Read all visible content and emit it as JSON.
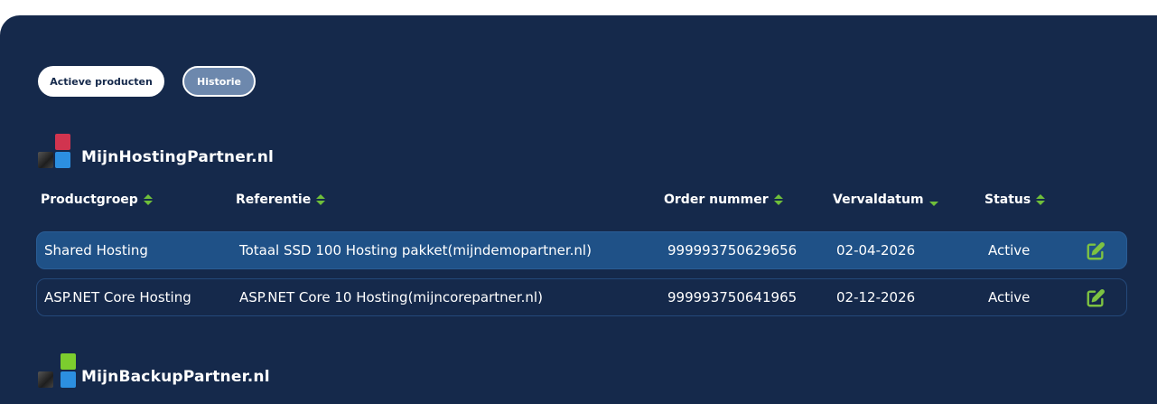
{
  "tabs": {
    "active": "Actieve producten",
    "history": "Historie"
  },
  "brands": [
    {
      "name": "MijnHostingPartner.nl",
      "logo_colors": [
        "#d1344f",
        "#2b2b2b",
        "#2c8fe0"
      ]
    },
    {
      "name": "MijnBackupPartner.nl",
      "logo_colors": [
        "#7ccd2e",
        "#2b2b2b",
        "#2c8fe0"
      ]
    }
  ],
  "table": {
    "columns": [
      "Productgroep",
      "Referentie",
      "Order nummer",
      "Vervaldatum",
      "Status"
    ],
    "rows": [
      {
        "productgroep": "Shared Hosting",
        "referentie": "Totaal SSD 100 Hosting pakket(mijndemopartner.nl)",
        "order": "999993750629656",
        "vervaldatum": "02-04-2026",
        "status": "Active"
      },
      {
        "productgroep": "ASP.NET Core Hosting",
        "referentie": "ASP.NET Core 10 Hosting(mijncorepartner.nl)",
        "order": "999993750641965",
        "vervaldatum": "02-12-2026",
        "status": "Active"
      }
    ]
  },
  "icons": {
    "sort": "sort-updown-icon",
    "sort_desc": "sort-desc-icon",
    "edit": "edit-icon"
  },
  "colors": {
    "panel": "#15294b",
    "row_highlight": "#1f5187",
    "accent_green": "#6fbf3a"
  }
}
